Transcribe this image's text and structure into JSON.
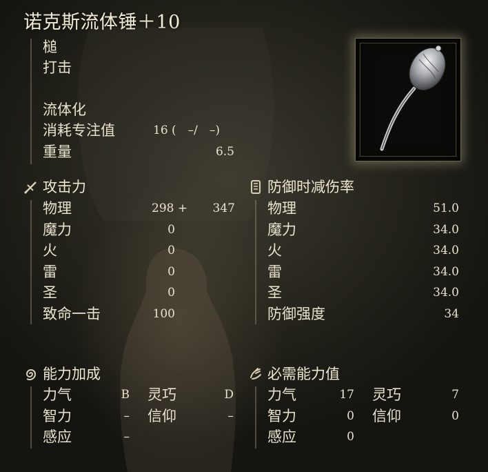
{
  "title": "诺克斯流体锤＋10",
  "weapon_type": "槌",
  "damage_type": "打击",
  "skill": {
    "name": "流体化",
    "fp_label": "消耗专注值",
    "fp_cost": "16 (　–/　–)",
    "weight_label": "重量",
    "weight": "6.5"
  },
  "attack": {
    "header": "攻击力",
    "rows": [
      {
        "label": "物理",
        "base": "298 +",
        "bonus": "347"
      },
      {
        "label": "魔力",
        "base": "0"
      },
      {
        "label": "火",
        "base": "0"
      },
      {
        "label": "雷",
        "base": "0"
      },
      {
        "label": "圣",
        "base": "0"
      },
      {
        "label": "致命一击",
        "base": "100"
      }
    ]
  },
  "guard": {
    "header": "防御时减伤率",
    "rows": [
      {
        "label": "物理",
        "value": "51.0"
      },
      {
        "label": "魔力",
        "value": "34.0"
      },
      {
        "label": "火",
        "value": "34.0"
      },
      {
        "label": "雷",
        "value": "34.0"
      },
      {
        "label": "圣",
        "value": "34.0"
      },
      {
        "label": "防御强度",
        "value": "34"
      }
    ]
  },
  "scaling": {
    "header": "能力加成",
    "rows": [
      {
        "l1": "力气",
        "v1": "B",
        "l2": "灵巧",
        "v2": "D"
      },
      {
        "l1": "智力",
        "v1": "–",
        "l2": "信仰",
        "v2": "–"
      },
      {
        "l1": "感应",
        "v1": "–"
      }
    ]
  },
  "requirements": {
    "header": "必需能力值",
    "rows": [
      {
        "l1": "力气",
        "v1": "17",
        "l2": "灵巧",
        "v2": "7"
      },
      {
        "l1": "智力",
        "v1": "0",
        "l2": "信仰",
        "v2": "0"
      },
      {
        "l1": "感应",
        "v1": "0"
      }
    ]
  },
  "icons": {
    "attack": "crossed-sword-icon",
    "guard": "shield-icon",
    "scaling": "spiral-icon",
    "requirements": "hand-icon",
    "weapon": "hammer-image"
  }
}
